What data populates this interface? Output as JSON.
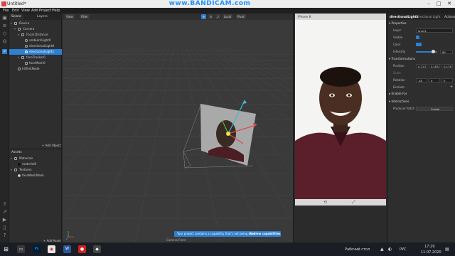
{
  "window": {
    "title": "Untitled*",
    "controls": [
      "–",
      "□",
      "✕"
    ]
  },
  "watermark": "www.BANDICAM.com",
  "menu": [
    "File",
    "Edit",
    "View",
    "Add",
    "Project",
    "Help"
  ],
  "scene_panel": {
    "tabs": [
      "Scene",
      "Layers"
    ],
    "tree": [
      {
        "label": "Device",
        "depth": 0,
        "selected": false
      },
      {
        "label": "Camera",
        "depth": 1,
        "selected": false
      },
      {
        "label": "Focal Distance",
        "depth": 2,
        "selected": false
      },
      {
        "label": "ambientLight0",
        "depth": 3,
        "selected": false
      },
      {
        "label": "directionalLight0",
        "depth": 3,
        "selected": false
      },
      {
        "label": "directionalLight1",
        "depth": 3,
        "selected": true
      },
      {
        "label": "faceTracker0",
        "depth": 2,
        "selected": false
      },
      {
        "label": "faceMesh0",
        "depth": 3,
        "selected": false
      },
      {
        "label": "hitTestNode",
        "depth": 1,
        "selected": false
      }
    ],
    "add_object": "+ Add Object"
  },
  "assets_panel": {
    "title": "Assets",
    "tree": [
      {
        "label": "Materials",
        "depth": 0
      },
      {
        "label": "material0",
        "depth": 1
      },
      {
        "label": "Textures",
        "depth": 0
      },
      {
        "label": "faceMeshMask",
        "depth": 1
      }
    ],
    "add_asset": "+ Add Asset"
  },
  "viewport": {
    "toolbar": {
      "view": "View",
      "filter": "Filter",
      "local": "Local",
      "pivot": "Pivot"
    },
    "notice": {
      "text": "Your project contains a capability that's not being used",
      "button": "Review capabilities"
    },
    "camera_label": "Camera Front"
  },
  "preview": {
    "device": "iPhone 8"
  },
  "inspector": {
    "title": "directionalLight1",
    "subtitle": "Directional Light",
    "action": "Actions",
    "sections": {
      "properties": "Properties",
      "transformations": "Transformations",
      "enable_for": "Enable For",
      "interactions": "Interactions"
    },
    "layer_label": "Layer",
    "layer_value": "layer1",
    "visible_label": "Visible",
    "color_label": "Color",
    "intensity_label": "Intensity",
    "intensity_value": "80",
    "intensity_fraction": 0.8,
    "position_label": "Position",
    "position": [
      "0.213",
      "0.165",
      "0.176"
    ],
    "scale_label": "Scale",
    "rotation_label": "Rotation",
    "rotation": [
      "-45",
      "0",
      "0"
    ],
    "exclude_label": "Exclude",
    "producer_patch_label": "Producer Patch",
    "create_button": "Create"
  },
  "taskbar": {
    "keyboard_layout": "Рабочий стол",
    "lang": "РУС",
    "time": "17:29",
    "date": "11.07.2020"
  }
}
